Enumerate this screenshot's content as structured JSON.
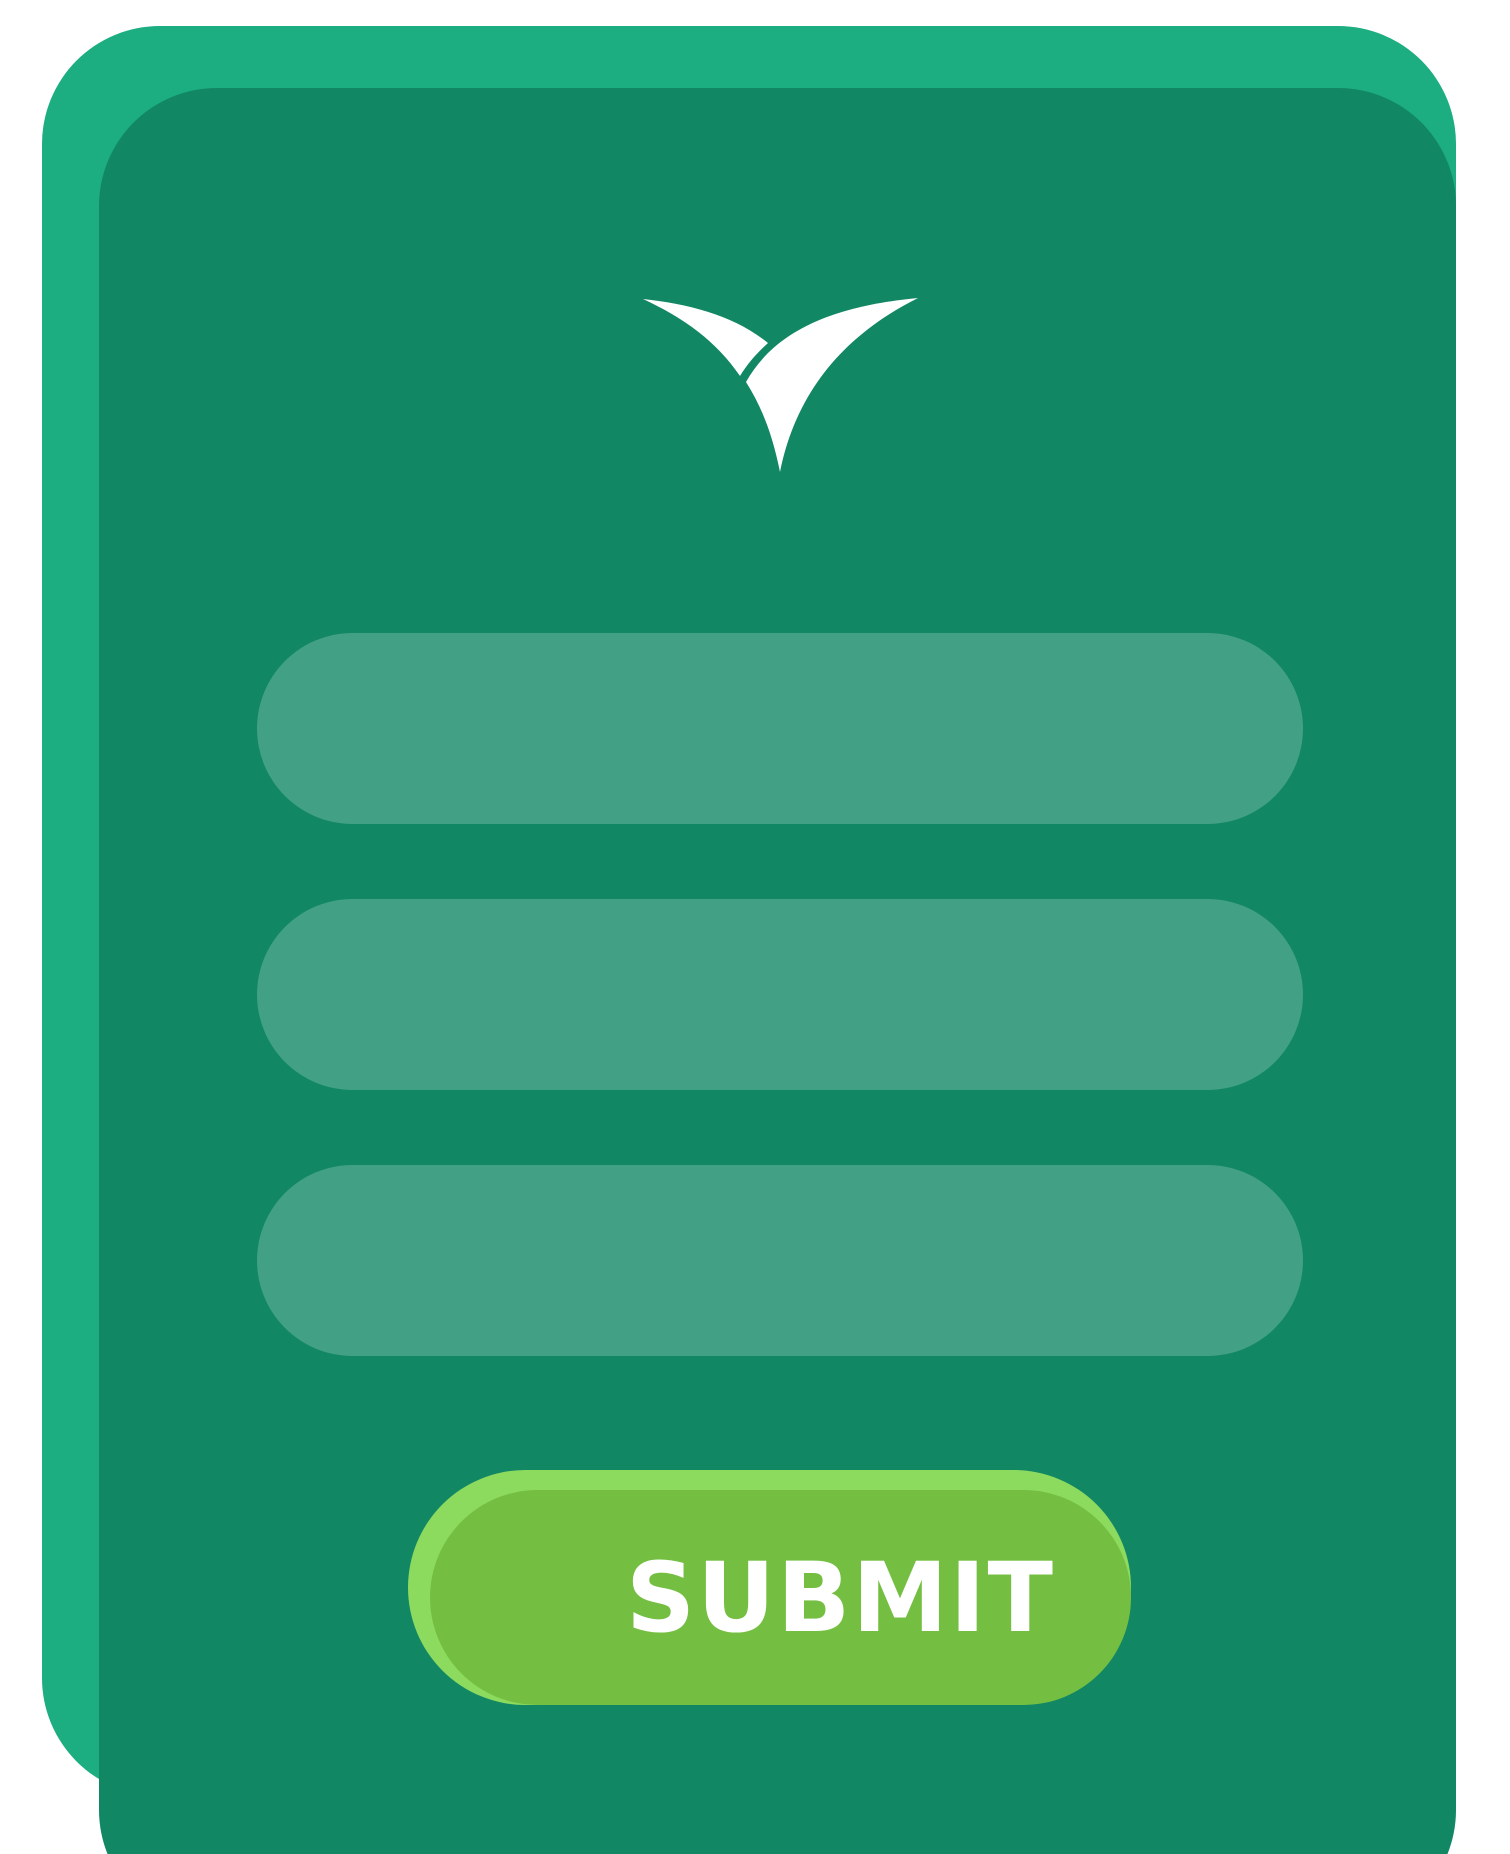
{
  "colors": {
    "card_back": "#1CAD80",
    "card_front": "#128764",
    "field": "#42A085",
    "button_back": "#8CDB5F",
    "button_front": "#74BF42",
    "logo": "#FFFFFF"
  },
  "logo": {
    "icon": "leaf-check-logo-icon"
  },
  "form": {
    "fields": [
      {
        "value": "",
        "placeholder": ""
      },
      {
        "value": "",
        "placeholder": ""
      },
      {
        "value": "",
        "placeholder": ""
      }
    ],
    "submit_label": "SUBMIT"
  }
}
